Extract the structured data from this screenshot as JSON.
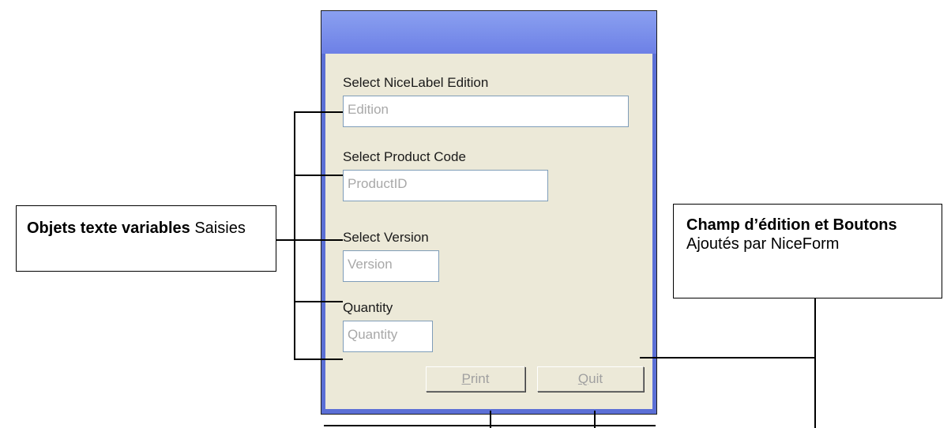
{
  "form": {
    "edition_label": "Select NiceLabel Edition",
    "edition_placeholder": "Edition",
    "product_label": "Select Product Code",
    "product_placeholder": "ProductID",
    "version_label": "Select Version",
    "version_placeholder": "Version",
    "quantity_label": "Quantity",
    "quantity_placeholder": "Quantity",
    "print_mnemonic": "P",
    "print_rest": "rint",
    "quit_mnemonic": "Q",
    "quit_rest": "uit"
  },
  "left_callout": {
    "bold": "Objets texte variables",
    "normal": "Saisies"
  },
  "right_callout": {
    "bold": "Champ d’édition et Boutons",
    "normal": "Ajoutés par NiceForm"
  }
}
